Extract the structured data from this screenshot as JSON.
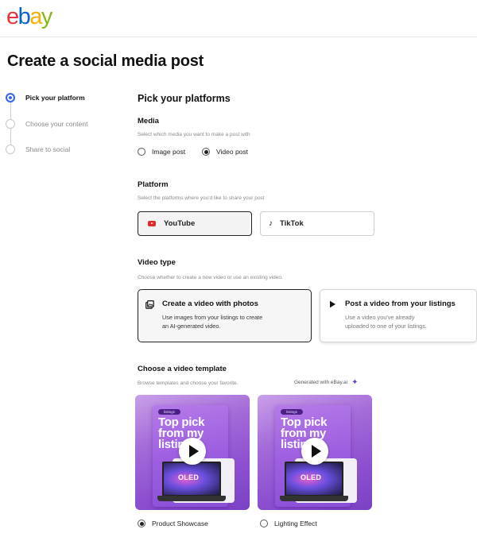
{
  "brand": {
    "logo_letters": [
      "e",
      "b",
      "a",
      "y"
    ],
    "logo_colors": [
      "#e53238",
      "#0064d2",
      "#f5af02",
      "#86b817"
    ]
  },
  "page": {
    "title": "Create a social media post"
  },
  "steps": [
    {
      "label": "Pick your platform",
      "active": true
    },
    {
      "label": "Choose your content",
      "active": false
    },
    {
      "label": "Share to social",
      "active": false
    }
  ],
  "main": {
    "heading": "Pick your platforms",
    "media": {
      "title": "Media",
      "subtitle": "Select which media you want to make a post with",
      "options": [
        {
          "label": "Image post",
          "checked": false
        },
        {
          "label": "Video post",
          "checked": true
        }
      ]
    },
    "platform": {
      "title": "Platform",
      "subtitle": "Select the platforms where you'd like to share your post",
      "options": [
        {
          "label": "YouTube",
          "icon": "youtube-icon",
          "selected": true
        },
        {
          "label": "TikTok",
          "icon": "tiktok-icon",
          "selected": false
        }
      ]
    },
    "video_type": {
      "title": "Video type",
      "subtitle": "Choose whether to create a new video or use an existing video.",
      "options": [
        {
          "title": "Create a video with photos",
          "desc_line1": "Use images from your listings to create",
          "desc_line2": "an AI-generated video.",
          "icon": "photos-icon",
          "selected": true
        },
        {
          "title": "Post a video from your listings",
          "desc_line1": "Use a video you've already",
          "desc_line2": "uploaded to one of your listings.",
          "icon": "play-icon",
          "selected": false
        }
      ]
    },
    "template": {
      "title": "Choose a video template",
      "subtitle": "Browse templates and choose your favorite.",
      "generated_label": "Generated with eBay.ai",
      "generated_icon": "sparkle-icon",
      "items": [
        {
          "name": "Product Showcase",
          "checked": true,
          "thumb_text": "Top pick\nfrom my\nlistin",
          "badge": "listings",
          "screen_text": "OLED"
        },
        {
          "name": "Lighting Effect",
          "checked": false,
          "thumb_text": "Top pick\nfrom my\nlistin",
          "badge": "listings",
          "screen_text": "OLED"
        }
      ]
    }
  }
}
